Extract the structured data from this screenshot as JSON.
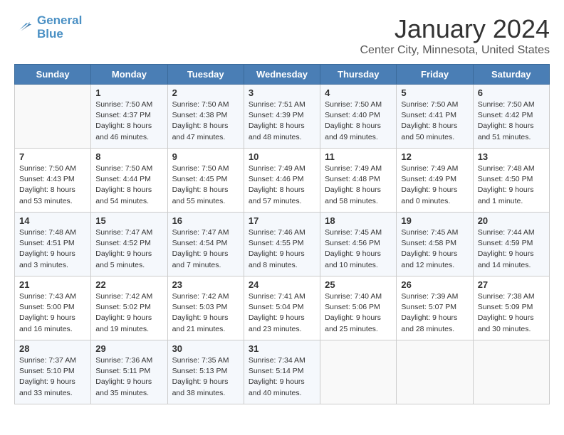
{
  "header": {
    "logo_line1": "General",
    "logo_line2": "Blue",
    "title": "January 2024",
    "subtitle": "Center City, Minnesota, United States"
  },
  "weekdays": [
    "Sunday",
    "Monday",
    "Tuesday",
    "Wednesday",
    "Thursday",
    "Friday",
    "Saturday"
  ],
  "weeks": [
    [
      {
        "day": "",
        "info": ""
      },
      {
        "day": "1",
        "info": "Sunrise: 7:50 AM\nSunset: 4:37 PM\nDaylight: 8 hours\nand 46 minutes."
      },
      {
        "day": "2",
        "info": "Sunrise: 7:50 AM\nSunset: 4:38 PM\nDaylight: 8 hours\nand 47 minutes."
      },
      {
        "day": "3",
        "info": "Sunrise: 7:51 AM\nSunset: 4:39 PM\nDaylight: 8 hours\nand 48 minutes."
      },
      {
        "day": "4",
        "info": "Sunrise: 7:50 AM\nSunset: 4:40 PM\nDaylight: 8 hours\nand 49 minutes."
      },
      {
        "day": "5",
        "info": "Sunrise: 7:50 AM\nSunset: 4:41 PM\nDaylight: 8 hours\nand 50 minutes."
      },
      {
        "day": "6",
        "info": "Sunrise: 7:50 AM\nSunset: 4:42 PM\nDaylight: 8 hours\nand 51 minutes."
      }
    ],
    [
      {
        "day": "7",
        "info": "Sunrise: 7:50 AM\nSunset: 4:43 PM\nDaylight: 8 hours\nand 53 minutes."
      },
      {
        "day": "8",
        "info": "Sunrise: 7:50 AM\nSunset: 4:44 PM\nDaylight: 8 hours\nand 54 minutes."
      },
      {
        "day": "9",
        "info": "Sunrise: 7:50 AM\nSunset: 4:45 PM\nDaylight: 8 hours\nand 55 minutes."
      },
      {
        "day": "10",
        "info": "Sunrise: 7:49 AM\nSunset: 4:46 PM\nDaylight: 8 hours\nand 57 minutes."
      },
      {
        "day": "11",
        "info": "Sunrise: 7:49 AM\nSunset: 4:48 PM\nDaylight: 8 hours\nand 58 minutes."
      },
      {
        "day": "12",
        "info": "Sunrise: 7:49 AM\nSunset: 4:49 PM\nDaylight: 9 hours\nand 0 minutes."
      },
      {
        "day": "13",
        "info": "Sunrise: 7:48 AM\nSunset: 4:50 PM\nDaylight: 9 hours\nand 1 minute."
      }
    ],
    [
      {
        "day": "14",
        "info": "Sunrise: 7:48 AM\nSunset: 4:51 PM\nDaylight: 9 hours\nand 3 minutes."
      },
      {
        "day": "15",
        "info": "Sunrise: 7:47 AM\nSunset: 4:52 PM\nDaylight: 9 hours\nand 5 minutes."
      },
      {
        "day": "16",
        "info": "Sunrise: 7:47 AM\nSunset: 4:54 PM\nDaylight: 9 hours\nand 7 minutes."
      },
      {
        "day": "17",
        "info": "Sunrise: 7:46 AM\nSunset: 4:55 PM\nDaylight: 9 hours\nand 8 minutes."
      },
      {
        "day": "18",
        "info": "Sunrise: 7:45 AM\nSunset: 4:56 PM\nDaylight: 9 hours\nand 10 minutes."
      },
      {
        "day": "19",
        "info": "Sunrise: 7:45 AM\nSunset: 4:58 PM\nDaylight: 9 hours\nand 12 minutes."
      },
      {
        "day": "20",
        "info": "Sunrise: 7:44 AM\nSunset: 4:59 PM\nDaylight: 9 hours\nand 14 minutes."
      }
    ],
    [
      {
        "day": "21",
        "info": "Sunrise: 7:43 AM\nSunset: 5:00 PM\nDaylight: 9 hours\nand 16 minutes."
      },
      {
        "day": "22",
        "info": "Sunrise: 7:42 AM\nSunset: 5:02 PM\nDaylight: 9 hours\nand 19 minutes."
      },
      {
        "day": "23",
        "info": "Sunrise: 7:42 AM\nSunset: 5:03 PM\nDaylight: 9 hours\nand 21 minutes."
      },
      {
        "day": "24",
        "info": "Sunrise: 7:41 AM\nSunset: 5:04 PM\nDaylight: 9 hours\nand 23 minutes."
      },
      {
        "day": "25",
        "info": "Sunrise: 7:40 AM\nSunset: 5:06 PM\nDaylight: 9 hours\nand 25 minutes."
      },
      {
        "day": "26",
        "info": "Sunrise: 7:39 AM\nSunset: 5:07 PM\nDaylight: 9 hours\nand 28 minutes."
      },
      {
        "day": "27",
        "info": "Sunrise: 7:38 AM\nSunset: 5:09 PM\nDaylight: 9 hours\nand 30 minutes."
      }
    ],
    [
      {
        "day": "28",
        "info": "Sunrise: 7:37 AM\nSunset: 5:10 PM\nDaylight: 9 hours\nand 33 minutes."
      },
      {
        "day": "29",
        "info": "Sunrise: 7:36 AM\nSunset: 5:11 PM\nDaylight: 9 hours\nand 35 minutes."
      },
      {
        "day": "30",
        "info": "Sunrise: 7:35 AM\nSunset: 5:13 PM\nDaylight: 9 hours\nand 38 minutes."
      },
      {
        "day": "31",
        "info": "Sunrise: 7:34 AM\nSunset: 5:14 PM\nDaylight: 9 hours\nand 40 minutes."
      },
      {
        "day": "",
        "info": ""
      },
      {
        "day": "",
        "info": ""
      },
      {
        "day": "",
        "info": ""
      }
    ]
  ]
}
